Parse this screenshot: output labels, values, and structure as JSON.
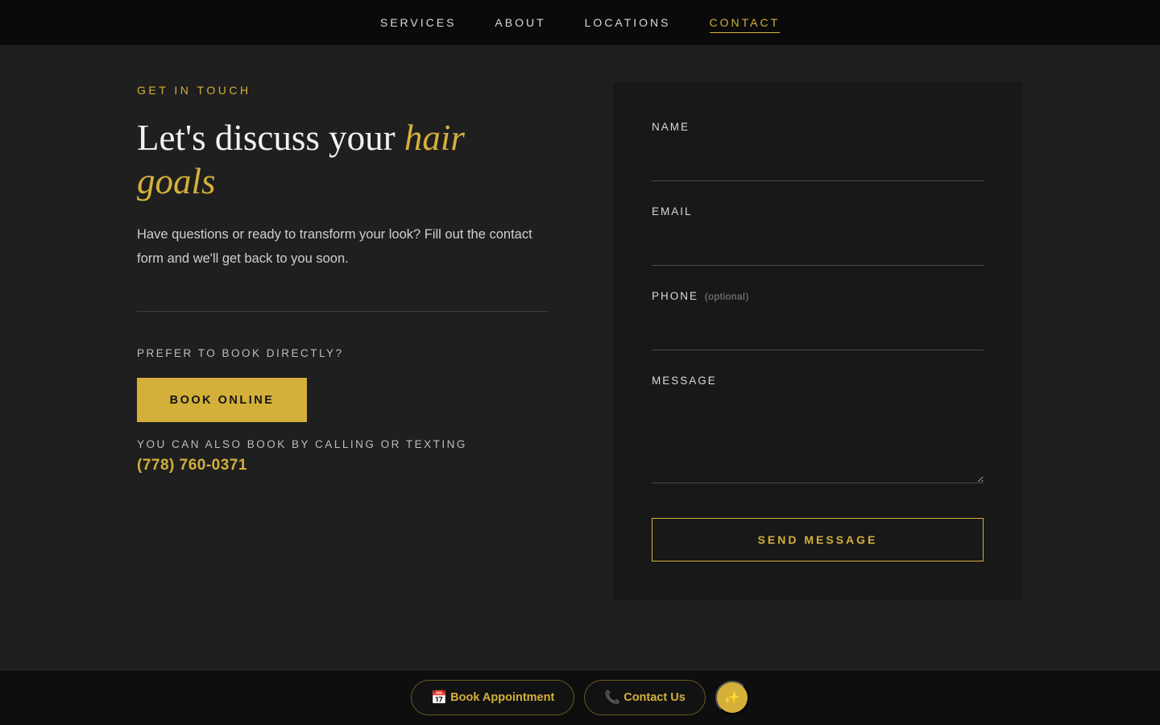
{
  "nav": {
    "items": [
      {
        "label": "SERVICES"
      },
      {
        "label": "ABOUT"
      },
      {
        "label": "LOCATIONS"
      },
      {
        "label": "CONTACT",
        "active": true
      }
    ]
  },
  "hero": {
    "eyebrow": "GET IN TOUCH",
    "headline_main": "Let's discuss your ",
    "headline_accent": "hair goals",
    "intro": "Have questions or ready to transform your look? Fill out the contact form and we'll get back to you soon."
  },
  "booking": {
    "prefer_label": "PREFER TO BOOK DIRECTLY?",
    "book_online_label": "BOOK ONLINE",
    "also_label": "YOU CAN ALSO BOOK BY CALLING OR TEXTING",
    "phone": "(778) 760-0371"
  },
  "form": {
    "name_label": "NAME",
    "name_value": "",
    "email_label": "EMAIL",
    "email_value": "",
    "phone_label": "PHONE",
    "phone_optional": "(optional)",
    "phone_value": "",
    "message_label": "MESSAGE",
    "message_value": "",
    "send_label": "SEND MESSAGE"
  },
  "bottom_bar": {
    "book_icon": "📅",
    "book_label": "Book Appointment",
    "contact_icon": "📞",
    "contact_label": "Contact Us",
    "sparkle_icon": "✨"
  },
  "colors": {
    "accent": "#d4b03a",
    "background": "#1f1f1f",
    "card": "#181818",
    "nav": "#0a0a0a"
  }
}
